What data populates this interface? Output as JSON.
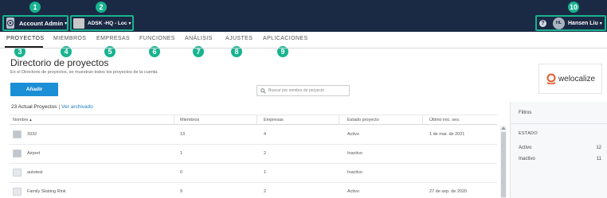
{
  "topbar": {
    "account_label": "Account Admin",
    "project_label": "ADSK -HQ - Loc",
    "user_initials": "HL",
    "user_name": "Hansen Liu",
    "help_glyph": "?"
  },
  "badges": [
    "1",
    "2",
    "3",
    "4",
    "5",
    "6",
    "7",
    "8",
    "9",
    "10"
  ],
  "nav": {
    "tabs": [
      {
        "label": "PROYECTOS",
        "active": true
      },
      {
        "label": "MIEMBROS"
      },
      {
        "label": "EMPRESAS"
      },
      {
        "label": "FUNCIONES"
      },
      {
        "label": "ANÁLISIS"
      },
      {
        "label": "AJUSTES"
      },
      {
        "label": "APLICACIONES"
      }
    ]
  },
  "header": {
    "title": "Directorio de proyectos",
    "subtitle": "En el Directorio de proyectos, se muestran todos los proyectos de la cuenta.",
    "add_button": "Añadir",
    "search_placeholder": "Buscar por nombre de proyecto",
    "logo_text": "welocalize"
  },
  "table": {
    "summary": "23 Actual Proyectos",
    "separator": "|",
    "archive_link": "Ver archivado",
    "columns": [
      "Nombre ▴",
      "Miembros",
      "Empresas",
      "Estado proyecto",
      "Último inic. ses."
    ],
    "rows": [
      {
        "name": "3332",
        "members": "13",
        "companies": "4",
        "status": "Activo",
        "last": "1 de mar. de 2021",
        "thumb": "img"
      },
      {
        "name": "Airport",
        "members": "1",
        "companies": "2",
        "status": "Inactivo",
        "last": "",
        "thumb": "img"
      },
      {
        "name": "autotest",
        "members": "0",
        "companies": "1",
        "status": "Inactivo",
        "last": "",
        "thumb": "blank"
      },
      {
        "name": "Family Skating Rink",
        "members": "9",
        "companies": "2",
        "status": "Activo",
        "last": "27 de sep. de 2020",
        "thumb": "blank"
      }
    ]
  },
  "filters": {
    "title": "Filtros",
    "section": "ESTADO",
    "items": [
      {
        "label": "Activo",
        "count": "12"
      },
      {
        "label": "Inactivo",
        "count": "11"
      }
    ]
  },
  "colors": {
    "topbar": "#1b2a44",
    "accent": "#18b38f",
    "primary_button": "#1a8fd6",
    "link": "#1a7fc1"
  }
}
